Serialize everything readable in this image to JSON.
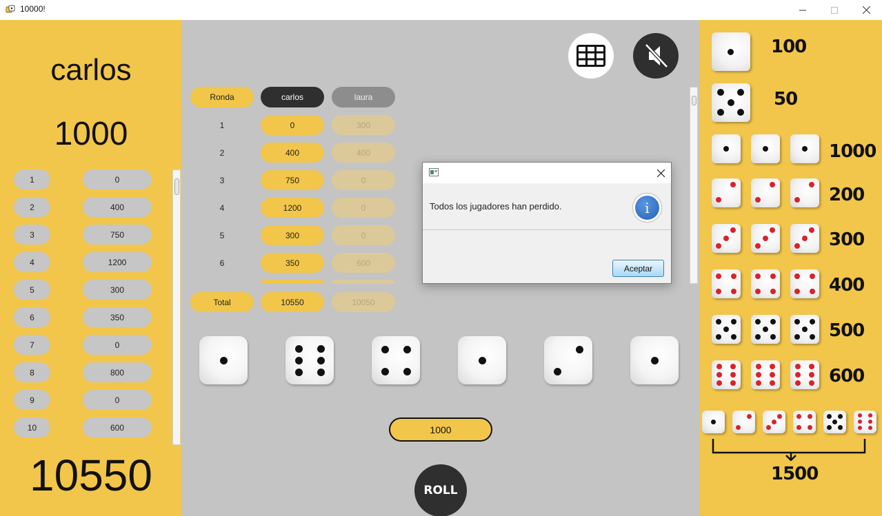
{
  "window": {
    "title": "10000!"
  },
  "player": {
    "name": "carlos",
    "turn_score": "1000",
    "total_score": "10550"
  },
  "history": [
    {
      "round": "1",
      "score": "0"
    },
    {
      "round": "2",
      "score": "400"
    },
    {
      "round": "3",
      "score": "750"
    },
    {
      "round": "4",
      "score": "1200"
    },
    {
      "round": "5",
      "score": "300"
    },
    {
      "round": "6",
      "score": "350"
    },
    {
      "round": "7",
      "score": "0"
    },
    {
      "round": "8",
      "score": "800"
    },
    {
      "round": "9",
      "score": "0"
    },
    {
      "round": "10",
      "score": "600"
    }
  ],
  "table": {
    "headers": {
      "round": "Ronda",
      "p1": "carlos",
      "p2": "laura"
    },
    "rows": [
      {
        "round": "1",
        "p1": "0",
        "p2": "300"
      },
      {
        "round": "2",
        "p1": "400",
        "p2": "400"
      },
      {
        "round": "3",
        "p1": "750",
        "p2": "0"
      },
      {
        "round": "4",
        "p1": "1200",
        "p2": "0"
      },
      {
        "round": "5",
        "p1": "300",
        "p2": "0"
      },
      {
        "round": "6",
        "p1": "350",
        "p2": "600"
      }
    ],
    "total": {
      "label": "Total",
      "p1": "10550",
      "p2": "10050"
    }
  },
  "dice": [
    1,
    6,
    4,
    1,
    2,
    1
  ],
  "current_roll": "1000",
  "roll_button": "ROLL",
  "icons": {
    "scoreboard": "table-grid-icon",
    "sound": "sound-muted-icon"
  },
  "legend": [
    {
      "value": "100"
    },
    {
      "value": "50"
    },
    {
      "value": "1000"
    },
    {
      "value": "200"
    },
    {
      "value": "300"
    },
    {
      "value": "400"
    },
    {
      "value": "500"
    },
    {
      "value": "600"
    },
    {
      "value": "1500"
    }
  ],
  "dialog": {
    "message": "Todos los jugadores han perdido.",
    "button": "Aceptar"
  },
  "colors": {
    "accent": "#f2c64a",
    "background": "#c4c4c4",
    "dark": "#2f2f2f",
    "pip_red": "#d8232a"
  }
}
